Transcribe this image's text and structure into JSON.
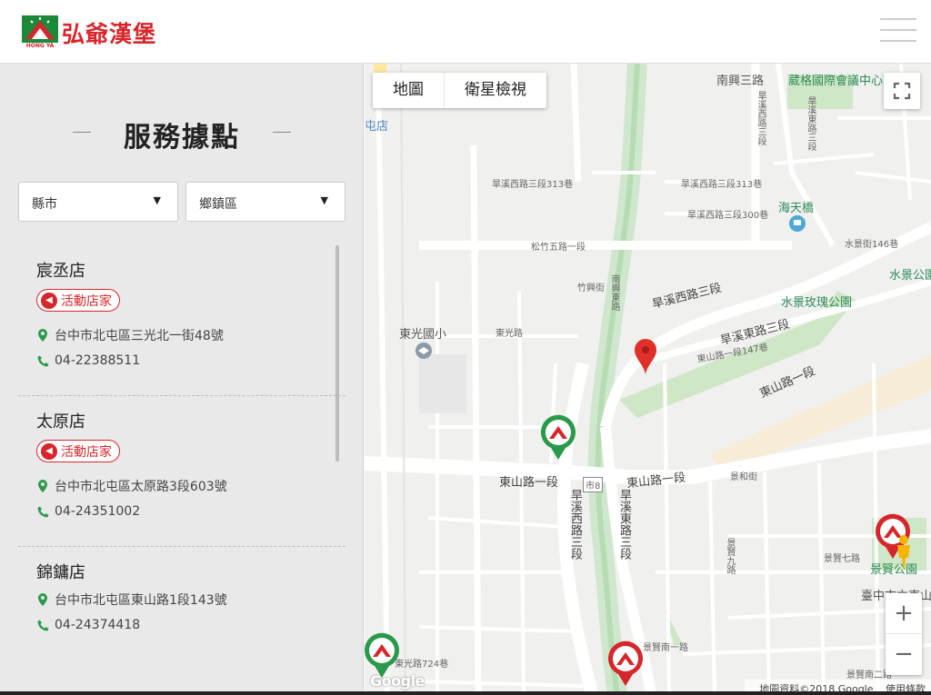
{
  "brand": {
    "name": "弘爺漢堡",
    "sub": "HONG YA",
    "color": "#d7262b"
  },
  "sidebar": {
    "title": "服務據點",
    "city_select": {
      "value": "縣市"
    },
    "district_select": {
      "value": "鄉鎮區"
    },
    "stores": [
      {
        "name": "宸丞店",
        "badge": "活動店家",
        "address": "台中市北屯區三光北一街48號",
        "phone": "04-22388511"
      },
      {
        "name": "太原店",
        "badge": "活動店家",
        "address": "台中市北屯區太原路3段603號",
        "phone": "04-24351002"
      },
      {
        "name": "錦鏞店",
        "address": "台中市北屯區東山路1段143號",
        "phone": "04-24374418"
      }
    ]
  },
  "map": {
    "tabs": [
      {
        "label": "地圖"
      },
      {
        "label": "衛星檢視"
      }
    ],
    "zoom_in": "+",
    "zoom_out": "−",
    "attribution": "地圖資料©2018 Google",
    "terms": "使用條款",
    "google": "Google",
    "labels": {
      "nanxing3": "南興三路",
      "weige": "葳格國際會議中心",
      "hanxi_w3": "旱溪西路三段",
      "hanxi_e3_top": "旱溪東路三段",
      "lane313a": "旱溪西路三段313巷",
      "lane313b": "旱溪西路三段313巷",
      "lane300": "旱溪西路三段300巷",
      "haitian": "海天橋",
      "songzhu5": "松竹五路一段",
      "songzhu5b": "松竹五路",
      "shuijing146": "水景街146巷",
      "shuijing_park": "水景公園",
      "zhuxing": "竹興街",
      "nanxingdong": "南興東路",
      "hanxi_w3b": "旱溪西路三段",
      "shuijing_rose": "水景玫瑰公園",
      "hanxi_e3b": "旱溪東路三段",
      "dongguang_school": "東光國小",
      "dongguang_rd": "東光路",
      "dongshan147": "東山路一段147巷",
      "dongshan1_e": "東山路一段",
      "dongshan1_w": "東山路一段",
      "dongshan1_c": "東山路一段",
      "jingxian": "景賢公園",
      "taichung_e": "臺中市立東山",
      "jinghe": "景和街",
      "jingxian7": "景賢七路",
      "jingxian9": "景賢九路",
      "jingxian2": "景賢南二路",
      "jingxian_s1": "景賢南一路",
      "dongguang724": "東光路724巷",
      "hanxi_e3c": "旱溪東路三段",
      "hanxi_w3c": "旱溪西路三段",
      "hwy8": "市8",
      "zhongshan": "屯店"
    }
  }
}
